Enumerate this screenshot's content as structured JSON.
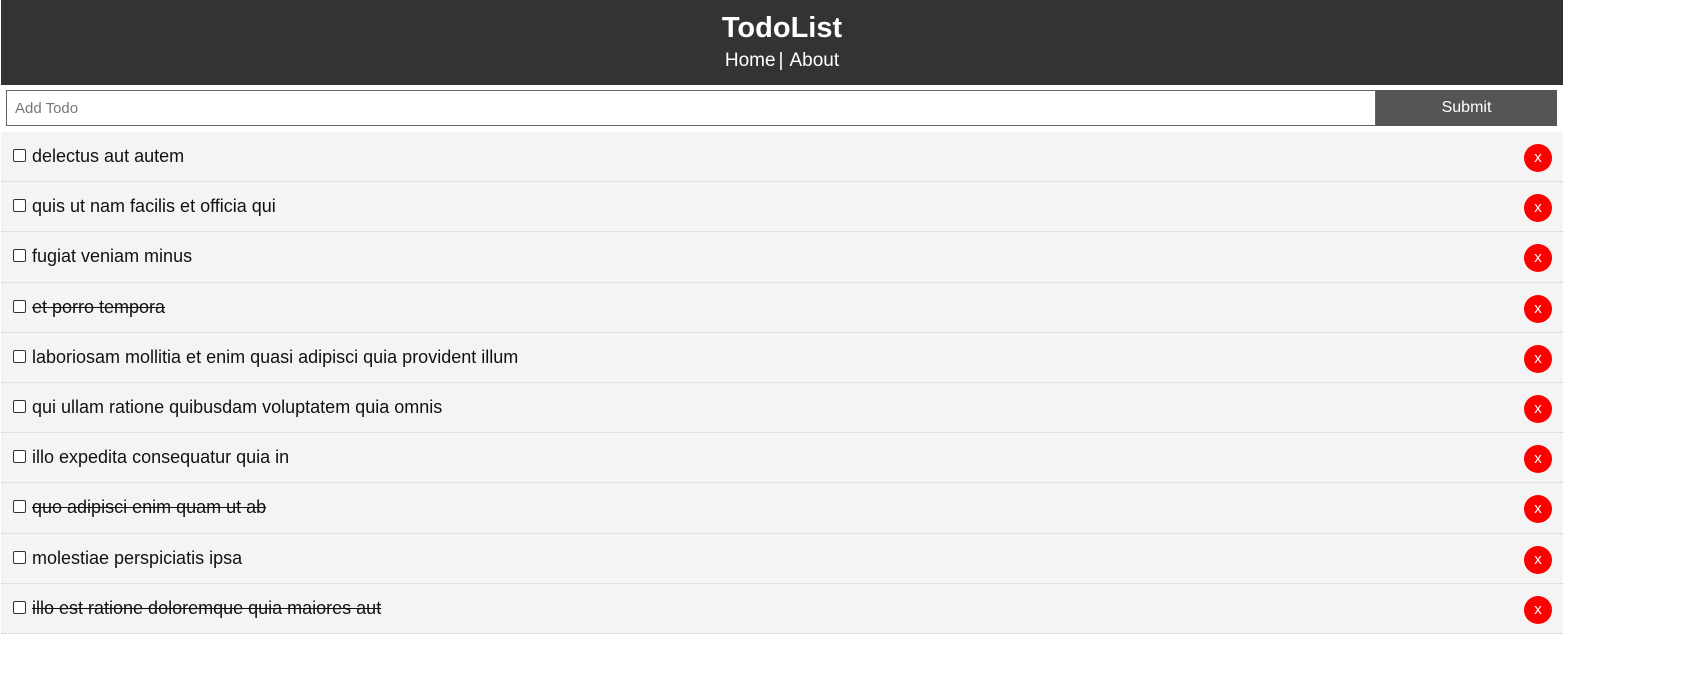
{
  "header": {
    "title": "TodoList",
    "nav": [
      {
        "label": "Home"
      },
      {
        "label": "About"
      }
    ],
    "separator": "|"
  },
  "add_form": {
    "placeholder": "Add Todo",
    "value": "",
    "submit_label": "Submit"
  },
  "todos": [
    {
      "title": "delectus aut autem",
      "completed": false,
      "delete_label": "x"
    },
    {
      "title": "quis ut nam facilis et officia qui",
      "completed": false,
      "delete_label": "x"
    },
    {
      "title": "fugiat veniam minus",
      "completed": false,
      "delete_label": "x"
    },
    {
      "title": "et porro tempora",
      "completed": true,
      "delete_label": "x"
    },
    {
      "title": "laboriosam mollitia et enim quasi adipisci quia provident illum",
      "completed": false,
      "delete_label": "x"
    },
    {
      "title": "qui ullam ratione quibusdam voluptatem quia omnis",
      "completed": false,
      "delete_label": "x"
    },
    {
      "title": "illo expedita consequatur quia in",
      "completed": false,
      "delete_label": "x"
    },
    {
      "title": "quo adipisci enim quam ut ab",
      "completed": true,
      "delete_label": "x"
    },
    {
      "title": "molestiae perspiciatis ipsa",
      "completed": false,
      "delete_label": "x"
    },
    {
      "title": "illo est ratione doloremque quia maiores aut",
      "completed": true,
      "delete_label": "x"
    }
  ],
  "colors": {
    "header_bg": "#333333",
    "submit_bg": "#555555",
    "item_bg": "#f4f4f4",
    "delete_bg": "#ff0000"
  }
}
